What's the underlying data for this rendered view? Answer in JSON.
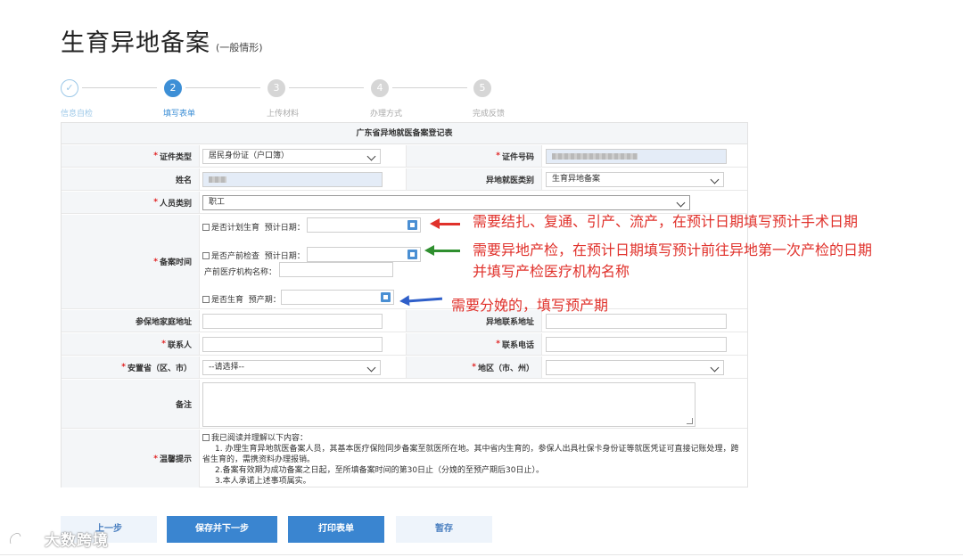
{
  "page": {
    "title": "生育异地备案",
    "subtitle": "(一般情形)"
  },
  "steps": [
    {
      "number": "✓",
      "label": "信息自检",
      "state": "done"
    },
    {
      "number": "2",
      "label": "填写表单",
      "state": "active"
    },
    {
      "number": "3",
      "label": "上传材料",
      "state": "todo"
    },
    {
      "number": "4",
      "label": "办理方式",
      "state": "todo"
    },
    {
      "number": "5",
      "label": "完成反馈",
      "state": "todo"
    }
  ],
  "form": {
    "title": "广东省异地就医备案登记表",
    "id_type_label": "证件类型",
    "id_type_value": "居民身份证（户口簿）",
    "id_number_label": "证件号码",
    "name_label": "姓名",
    "medical_category_label": "异地就医类别",
    "medical_category_value": "生育异地备案",
    "person_type_label": "人员类别",
    "person_type_value": "职工",
    "record_time_label": "备案时间",
    "planned_birth_label": "是否计划生育",
    "planned_birth_date_label": "预计日期：",
    "prenatal_label": "是否产前检查",
    "prenatal_date_label": "预计日期：",
    "prenatal_org_label": "产前医疗机构名称：",
    "birth_label": "是否生育",
    "due_date_label": "预产期：",
    "home_address_label": "参保地家庭地址",
    "remote_address_label": "异地联系地址",
    "contact_label": "联系人",
    "contact_phone_label": "联系电话",
    "settle_province_label": "安置省（区、市）",
    "settle_province_value": "--请选择--",
    "region_label": "地区（市、州）",
    "remarks_label": "备注",
    "notice_label": "温馨提示",
    "notice_lines": [
      "我已阅读并理解以下内容：",
      "1. 办理生育异地就医备案人员，其基本医疗保险同步备案至就医所在地。其中省内生育的，参保人出具社保卡身份证等就医凭证可直接记账处理，跨",
      "省生育的，需携资料办理报销。",
      "2.备案有效期为成功备案之日起，至所填备案时间的第30日止（分娩的至预产期后30日止）。",
      "3.本人承诺上述事项属实。"
    ]
  },
  "annotations": {
    "red": "需要结扎、复通、引产、流产，在预计日期填写预计手术日期",
    "green_line1": "需要异地产检，在预计日期填写预计前往异地第一次产检的日期",
    "green_line2": "并填写产检医疗机构名称",
    "blue": "需要分娩的，填写预产期",
    "red_color": "#e0312b",
    "green_color": "#2f8f2f",
    "blue_color": "#2f5fc9"
  },
  "buttons": {
    "prev": "上一步",
    "save_next": "保存并下一步",
    "print": "打印表单",
    "hold": "暂存"
  },
  "watermark": "大数跨境"
}
